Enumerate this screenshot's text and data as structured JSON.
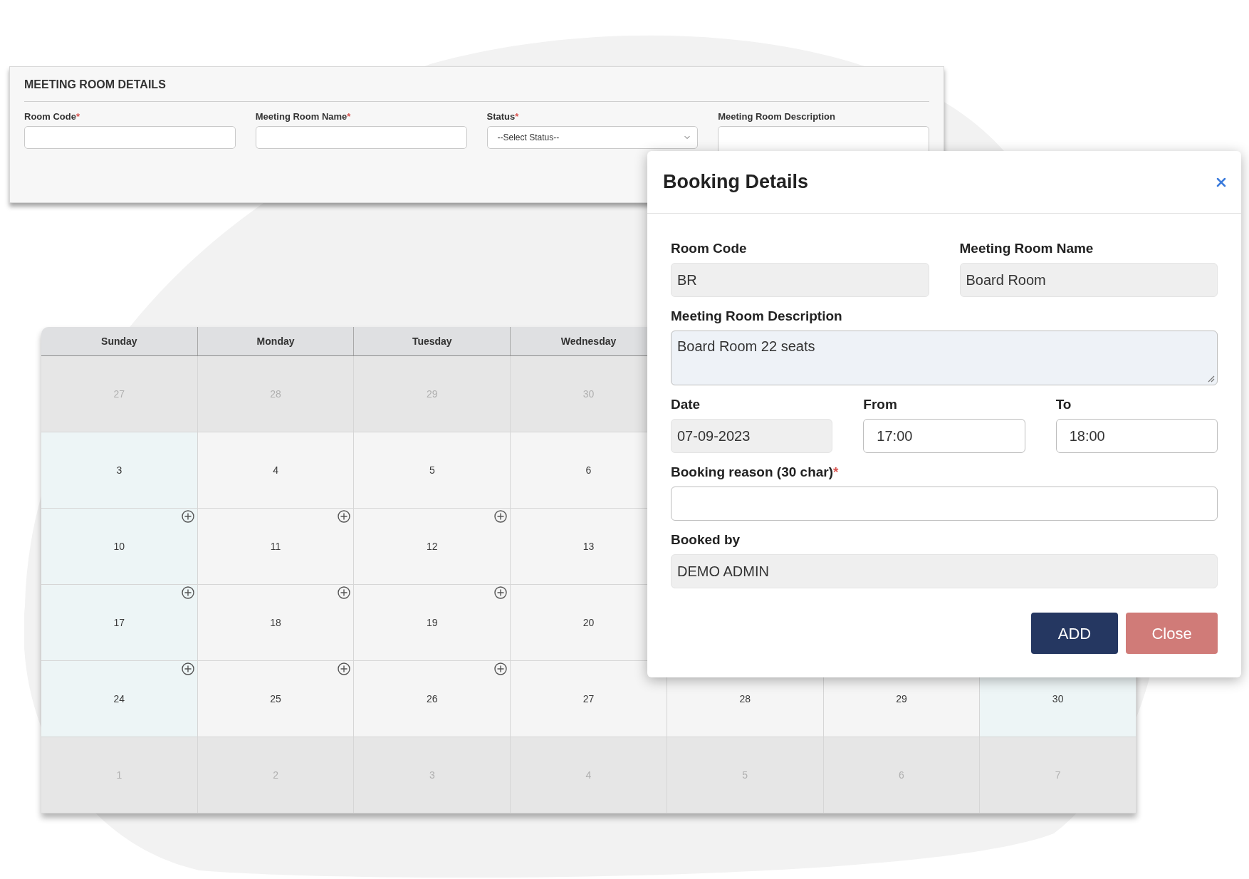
{
  "meeting_room_panel": {
    "title": "MEETING ROOM DETAILS",
    "fields": [
      {
        "label": "Room Code",
        "required_mark": "*",
        "kind": "text"
      },
      {
        "label": "Meeting Room Name",
        "required_mark": "*",
        "kind": "text"
      },
      {
        "label": "Status",
        "required_mark": "*",
        "kind": "select",
        "value": "--Select Status--"
      },
      {
        "label": "Meeting Room Description",
        "kind": "textarea"
      }
    ]
  },
  "calendar": {
    "weekdays": [
      "Sunday",
      "Monday",
      "Tuesday",
      "Wednesday"
    ],
    "weeks": [
      {
        "days": [
          {
            "label": "27",
            "kind": "other_month",
            "add_button": false
          },
          {
            "label": "28",
            "kind": "other_month",
            "add_button": false
          },
          {
            "label": "29",
            "kind": "other_month",
            "add_button": false
          },
          {
            "label": "30",
            "kind": "other_month"
          }
        ]
      },
      {
        "days": [
          {
            "label": "3",
            "kind": "weekend",
            "add_button": false
          },
          {
            "label": "4",
            "kind": "weekday",
            "add_button": false
          },
          {
            "label": "5",
            "kind": "weekday",
            "add_button": false
          },
          {
            "label": "6",
            "kind": "weekday"
          }
        ]
      },
      {
        "days": [
          {
            "label": "10",
            "kind": "weekend",
            "add_button": true
          },
          {
            "label": "11",
            "kind": "weekday",
            "add_button": true
          },
          {
            "label": "12",
            "kind": "weekday",
            "add_button": true
          },
          {
            "label": "13",
            "kind": "weekday"
          }
        ]
      },
      {
        "days": [
          {
            "label": "17",
            "kind": "weekend",
            "add_button": true
          },
          {
            "label": "18",
            "kind": "weekday",
            "add_button": true
          },
          {
            "label": "19",
            "kind": "weekday",
            "add_button": true
          },
          {
            "label": "20",
            "kind": "weekday"
          }
        ]
      },
      {
        "days": [
          {
            "label": "24",
            "kind": "weekend",
            "add_button": true
          },
          {
            "label": "25",
            "kind": "weekday",
            "add_button": true
          },
          {
            "label": "26",
            "kind": "weekday",
            "add_button": true
          },
          {
            "label": "27",
            "kind": "weekday"
          },
          {
            "label": "28",
            "kind": "weekday"
          },
          {
            "label": "29",
            "kind": "weekday"
          },
          {
            "label": "30",
            "kind": "weekend"
          }
        ]
      },
      {
        "days": [
          {
            "label": "1",
            "kind": "other_month",
            "add_button": false
          },
          {
            "label": "2",
            "kind": "other_month",
            "add_button": false
          },
          {
            "label": "3",
            "kind": "other_month",
            "add_button": false
          },
          {
            "label": "4",
            "kind": "other_month",
            "add_button": false
          },
          {
            "label": "5",
            "kind": "other_month",
            "add_button": false
          },
          {
            "label": "6",
            "kind": "other_month",
            "add_button": false
          },
          {
            "label": "7",
            "kind": "other_month",
            "add_button": false
          }
        ]
      }
    ]
  },
  "booking_dialog": {
    "title": "Booking Details",
    "rows": [
      {
        "fields": [
          {
            "label": "Room Code",
            "kind": "input",
            "readonly": true,
            "value": "BR"
          },
          {
            "label": "Meeting Room Name",
            "kind": "input",
            "readonly": true,
            "value": "Board Room"
          }
        ]
      },
      {
        "fields": [
          {
            "label": "Meeting Room Description",
            "kind": "textarea",
            "readonly": true,
            "value": "Board Room 22 seats"
          }
        ]
      },
      {
        "fields": [
          {
            "label": "Date",
            "kind": "input",
            "readonly": true,
            "value": "07-09-2023"
          },
          {
            "label": "From",
            "kind": "input",
            "readonly": false,
            "value": "17:00"
          },
          {
            "label": "To",
            "kind": "input",
            "readonly": false,
            "value": "18:00"
          }
        ]
      },
      {
        "fields": [
          {
            "label": "Booking reason (30 char)",
            "required_mark": "*",
            "kind": "input",
            "readonly": false
          }
        ]
      },
      {
        "fields": [
          {
            "label": "Booked by",
            "kind": "input",
            "readonly": true,
            "value": "DEMO ADMIN"
          }
        ]
      }
    ],
    "buttons": [
      {
        "label": "ADD",
        "kind": "primary"
      },
      {
        "label": "Close",
        "kind": "danger"
      }
    ]
  }
}
